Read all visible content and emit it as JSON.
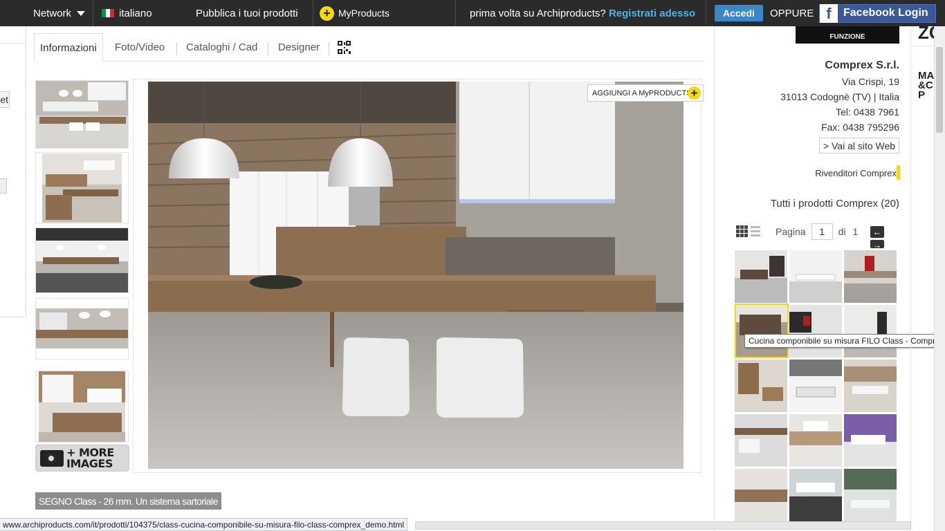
{
  "topbar": {
    "network_label": "Network",
    "language": "italiano",
    "publish": "Pubblica i tuoi prodotti",
    "myproducts": "MyProducts",
    "first_time": "prima volta su Archiproducts?",
    "register": "Registrati adesso",
    "login": "Accedi",
    "or": "OPPURE",
    "facebook": "Facebook Login",
    "accent_blue": "#3a87c9",
    "highlight_yellow": "#f5d90a"
  },
  "left_fragment": {
    "partial_text": "et"
  },
  "tabs": [
    {
      "label": "Informazioni",
      "active": true
    },
    {
      "label": "Foto/Video",
      "active": false
    },
    {
      "label": "Cataloghi / Cad",
      "active": false
    },
    {
      "label": "Designer",
      "active": false
    }
  ],
  "gallery": {
    "more_images": [
      "+ MORE",
      "IMAGES"
    ],
    "add_to_myproducts": "AGGIUNGI A MyPRODUCTS",
    "caption": "SEGNO Class - 26 mm. Un sistema sartoriale"
  },
  "company": {
    "logo_text": "FUNZIONE",
    "name": "Comprex S.r.l.",
    "address": "Via Crispi, 19",
    "city": "31013 Codognè (TV) | Italia",
    "tel": "Tel: 0438 7961",
    "fax": "Fax: 0438 795296",
    "website": "> Vai al sito Web",
    "dealers": "Rivenditori Comprex"
  },
  "products": {
    "title": "Tutti i prodotti Comprex (20)",
    "page_label": "Pagina",
    "page_value": "1",
    "of_label": "di",
    "total_pages": "1",
    "tooltip": "Cucina componibile su misura FILO Class - Comprex"
  },
  "far_right": {
    "fragment_1": "ZC",
    "fragment_2": "MA &C P"
  },
  "status_url": "www.archiproducts.com/it/prodotti/104375/class-cucina-componibile-su-misura-filo-class-comprex_demo.html"
}
